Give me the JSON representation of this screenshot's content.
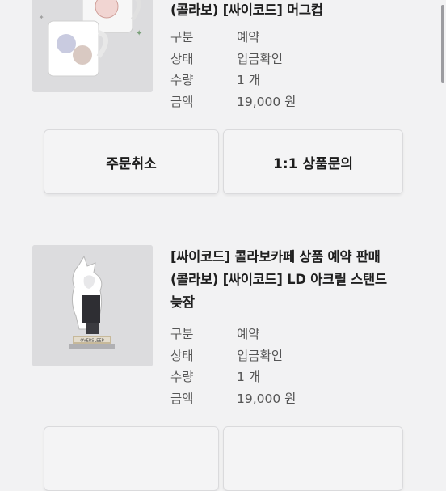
{
  "orders": [
    {
      "title_lines": [
        "(콜라보) [싸이코드] 머그컵"
      ],
      "info": [
        {
          "key": "구분",
          "value": "예약"
        },
        {
          "key": "상태",
          "value": "입금확인"
        },
        {
          "key": "수량",
          "value": "1 개"
        },
        {
          "key": "금액",
          "value": "19,000 원"
        }
      ],
      "thumb_text": "",
      "buttons": {
        "cancel": "주문취소",
        "inquiry": "1:1 상품문의"
      }
    },
    {
      "title_lines": [
        "[싸이코드] 콜라보카페 상품 예약 판매",
        "(콜라보) [싸이코드] LD 아크릴 스탠드",
        "늦잠"
      ],
      "info": [
        {
          "key": "구분",
          "value": "예약"
        },
        {
          "key": "상태",
          "value": "입금확인"
        },
        {
          "key": "수량",
          "value": "1 개"
        },
        {
          "key": "금액",
          "value": "19,000 원"
        }
      ],
      "thumb_text": "OVERSLEEP",
      "buttons": {
        "cancel": "",
        "inquiry": ""
      }
    }
  ],
  "colors": {
    "background": "#f2f2f3",
    "button_bg": "#f4f4f5",
    "thumb_bg": "#dcdcde"
  },
  "icons": [
    "mug-product-image",
    "acrylic-stand-product-image"
  ]
}
